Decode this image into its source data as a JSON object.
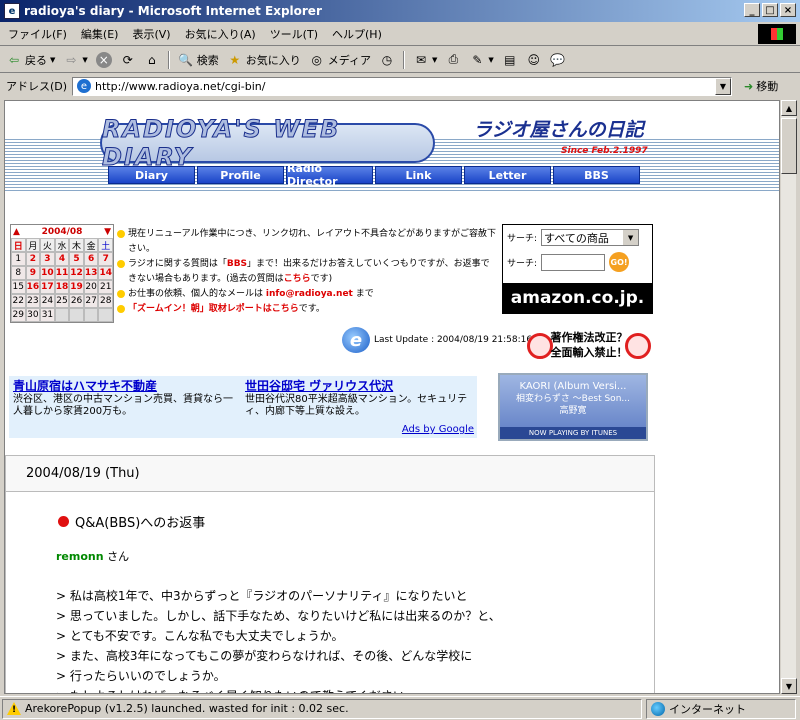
{
  "window": {
    "title": "radioya's diary - Microsoft Internet Explorer"
  },
  "menu": [
    "ファイル(F)",
    "編集(E)",
    "表示(V)",
    "お気に入り(A)",
    "ツール(T)",
    "ヘルプ(H)"
  ],
  "toolbar": {
    "back": "戻る",
    "search": "検索",
    "favorites": "お気に入り",
    "media": "メディア"
  },
  "address": {
    "label": "アドレス(D)",
    "url": "http://www.radioya.net/cgi-bin/",
    "go": "移動"
  },
  "header": {
    "logo_text": "RADIOYA'S WEB DIARY",
    "japanese_title": "ラジオ屋さんの日記",
    "since": "Since Feb.2.1997",
    "nav": [
      "Diary",
      "Profile",
      "Radio Director",
      "Link",
      "Letter",
      "BBS"
    ]
  },
  "calendar": {
    "title": "2004/08",
    "weekdays": [
      "日",
      "月",
      "火",
      "水",
      "木",
      "金",
      "土"
    ],
    "days": [
      "1",
      "2",
      "3",
      "4",
      "5",
      "6",
      "7",
      "8",
      "9",
      "10",
      "11",
      "12",
      "13",
      "14",
      "15",
      "16",
      "17",
      "18",
      "19",
      "20",
      "21",
      "22",
      "23",
      "24",
      "25",
      "26",
      "27",
      "28",
      "29",
      "30",
      "31"
    ]
  },
  "notes": {
    "n1": "現在リニューアル作業中につき、リンク切れ、レイアウト不具合などがありますがご容赦下さい。",
    "n2a": "ラジオに関する質問は「",
    "n2b": "BBS",
    "n2c": "」まで！出来るだけお答えしていくつもりですが、お返事できない場合もあります。(過去の質問は",
    "n2d": "こちら",
    "n2e": "です)",
    "n3a": "お仕事の依頼、個人的なメールは ",
    "n3b": "info@radioya.net",
    "n3c": " まで",
    "n4a": "「ズームイン！朝」取材レポートはこちら",
    "n4b": "です。"
  },
  "amazon": {
    "label1": "サーチ:",
    "select": "すべての商品",
    "label2": "サーチ:",
    "go": "GO!",
    "logo": "amazon.co.jp."
  },
  "update": {
    "text": "Last Update : 2004/08/19 21:58:16"
  },
  "copyright": {
    "line1": "著作権法改正？",
    "line2": "全面輸入禁止！"
  },
  "ads": {
    "ad1_title": "青山原宿はハマサキ不動産",
    "ad1_text": "渋谷区、港区の中古マンション売買、賃貸なら一人暮しから家賃200万も。",
    "ad2_title": "世田谷邸宅 ヴァリウス代沢",
    "ad2_text": "世田谷代沢80平米超高級マンション。セキュリティ、内廊下等上質な設え。",
    "by": "Ads by Google"
  },
  "itunes": {
    "line1": "KAORI (Album Versi...",
    "line2": "相変わらずさ ～Best Son...",
    "line3": "高野寛",
    "bar": "NOW PLAYING BY ITUNES"
  },
  "entry": {
    "date": "2004/08/19 (Thu)",
    "title": "Q&A(BBS)へのお返事",
    "author": "remonn",
    "author_suffix": " さん",
    "lines": [
      "> 私は高校1年で、中3からずっと『ラジオのパーソナリティ』になりたいと",
      "> 思っていました。しかし、話下手なため、なりたいけど私には出来るのか？と、",
      "> とても不安です。こんな私でも大丈夫でしょうか。",
      "> また、高校3年になってもこの夢が変わらなければ、その後、どんな学校に",
      "> 行ったらいいのでしょうか。",
      "> もしよろしければ、なるべく早く知りたいので教えてください。"
    ]
  },
  "status": {
    "text": "ArekorePopup (v1.2.5) launched. wasted for init : 0.02 sec.",
    "zone": "インターネット"
  }
}
